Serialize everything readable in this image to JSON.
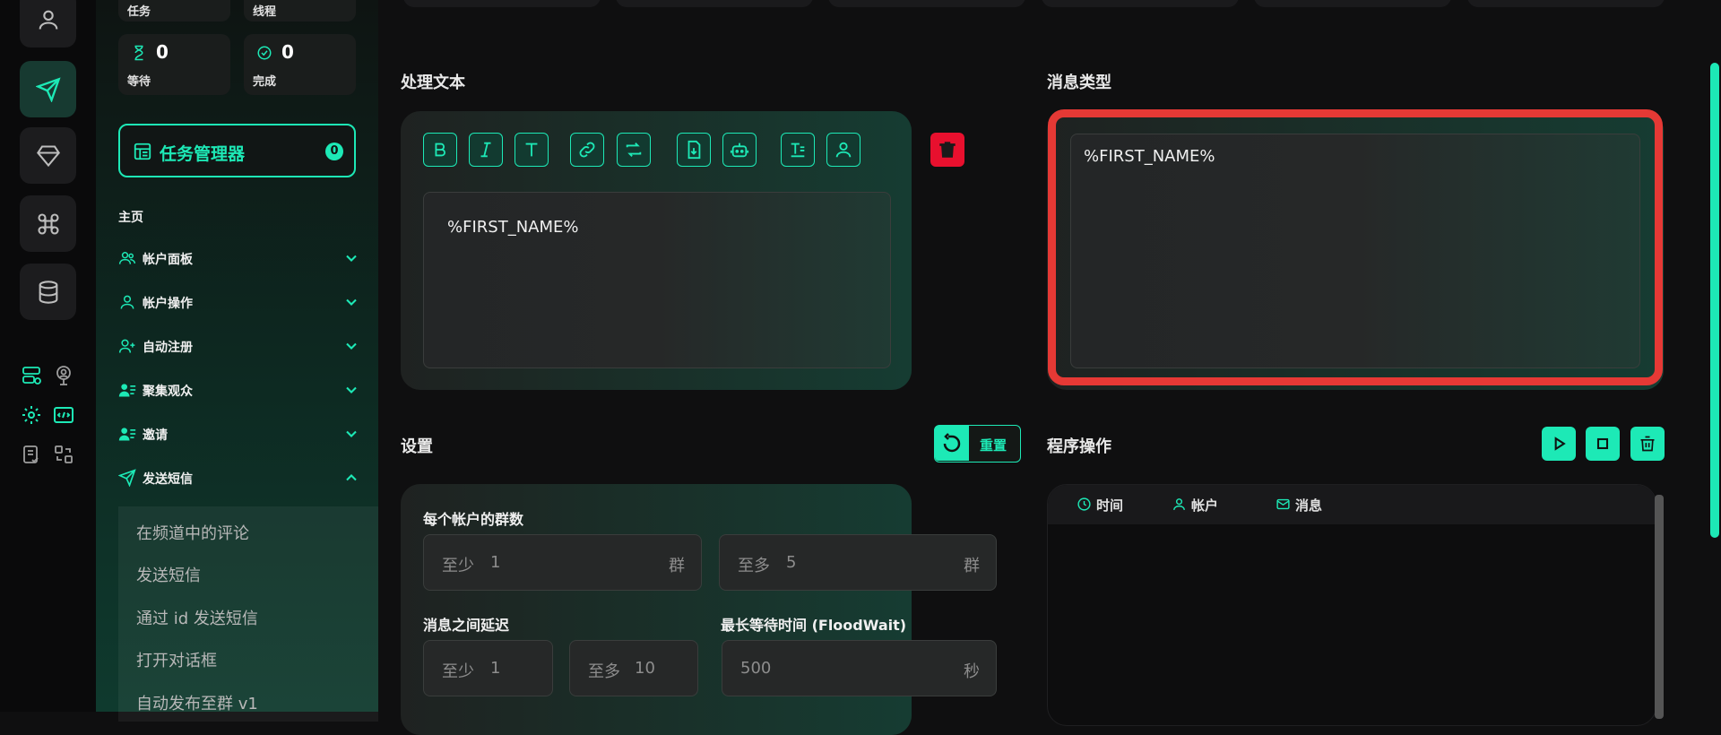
{
  "sidebar": {
    "stats_top": [
      "任务",
      "线程"
    ],
    "stats": [
      {
        "value": "0",
        "label": "等待"
      },
      {
        "value": "0",
        "label": "完成"
      }
    ],
    "task_manager": {
      "label": "任务管理器",
      "count": "0"
    },
    "nav_head": "主页",
    "items": [
      {
        "label": "帐户面板"
      },
      {
        "label": "帐户操作"
      },
      {
        "label": "自动注册"
      },
      {
        "label": "聚集观众"
      },
      {
        "label": "邀请"
      },
      {
        "label": "发送短信"
      }
    ],
    "sub_items": [
      "在频道中的评论",
      "发送短信",
      "通过 id 发送短信",
      "打开对话框",
      "自动发布至群 v1"
    ]
  },
  "main": {
    "text_section": {
      "title": "处理文本",
      "text": "%FIRST_NAME%"
    },
    "message_type": {
      "title": "消息类型",
      "text": "%FIRST_NAME%"
    },
    "settings": {
      "title": "设置",
      "reset_label": "重置",
      "groups_per_account": {
        "label": "每个帐户的群数",
        "min_prefix": "至少",
        "min_value": "1",
        "min_unit": "群",
        "max_prefix": "至多",
        "max_value": "5",
        "max_unit": "群"
      },
      "delay": {
        "label": "消息之间延迟",
        "min_prefix": "至少",
        "min_value": "1",
        "max_prefix": "至多",
        "max_value": "10"
      },
      "floodwait": {
        "label": "最长等待时间 (FloodWait)",
        "value": "500",
        "unit": "秒"
      }
    },
    "program": {
      "title": "程序操作",
      "columns": [
        "时间",
        "帐户",
        "消息"
      ]
    }
  },
  "colors": {
    "accent": "#1de9b6",
    "danger": "#e8102e",
    "highlight": "#e53935"
  }
}
